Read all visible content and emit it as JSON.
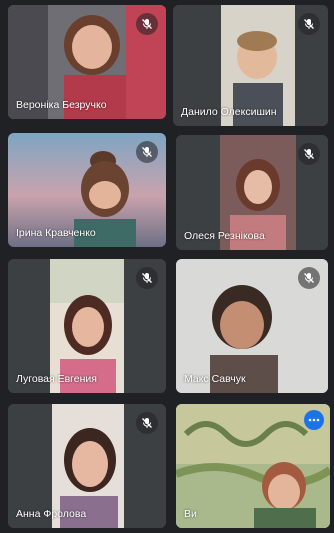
{
  "window": {
    "background": "#202124",
    "active_outline": "#8ab4f8"
  },
  "participants": [
    {
      "name": "Вероніка Безручко",
      "mic": "mic-off-icon",
      "muted": true,
      "video": true
    },
    {
      "name": "Данило Олексишин",
      "mic": "mic-off-icon",
      "muted": true,
      "video": true
    },
    {
      "name": "Ірина Кравченко",
      "mic": "mic-off-icon",
      "muted": true,
      "video": true
    },
    {
      "name": "Олеся Резнікова",
      "mic": "mic-off-icon",
      "muted": true,
      "video": true
    },
    {
      "name": "Луговая Евгения",
      "mic": "mic-off-icon",
      "muted": true,
      "video": true
    },
    {
      "name": "Макс Савчук",
      "mic": "mic-off-icon",
      "muted": true,
      "video": true
    },
    {
      "name": "Анна Фролова",
      "mic": "mic-off-icon",
      "muted": true,
      "video": true
    },
    {
      "name": "Ви",
      "mic": "more-options-icon",
      "muted": false,
      "video": true,
      "self": true
    }
  ]
}
